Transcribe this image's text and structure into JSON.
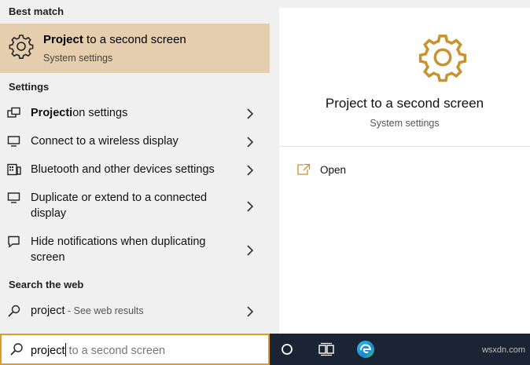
{
  "sections": {
    "best_match": "Best match",
    "settings": "Settings",
    "search_web": "Search the web"
  },
  "best_match": {
    "title_bold": "Project",
    "title_rest": " to a second screen",
    "subtitle": "System settings",
    "icon": "gear-icon"
  },
  "settings_items": [
    {
      "bold": "Projecti",
      "rest": "on settings",
      "icon": "projection-icon"
    },
    {
      "bold": "",
      "rest": "Connect to a wireless display",
      "icon": "monitor-icon"
    },
    {
      "bold": "",
      "rest": "Bluetooth and other devices settings",
      "icon": "devices-icon"
    },
    {
      "bold": "",
      "rest": "Duplicate or extend to a connected display",
      "icon": "monitor-icon"
    },
    {
      "bold": "",
      "rest": "Hide notifications when duplicating screen",
      "icon": "speech-bubble-icon"
    }
  ],
  "web_result": {
    "query": "project",
    "hint": " - See web results",
    "icon": "search-icon"
  },
  "search_box": {
    "typed": "project",
    "ghost": " to a second screen"
  },
  "preview": {
    "title": "Project to a second screen",
    "subtitle": "System settings",
    "open_label": "Open"
  },
  "watermark": "wsxdn.com",
  "colors": {
    "accent": "#c8922e",
    "selected_bg": "#e5ceae",
    "search_border": "#e09a2a",
    "taskbar": "#1b2435"
  }
}
